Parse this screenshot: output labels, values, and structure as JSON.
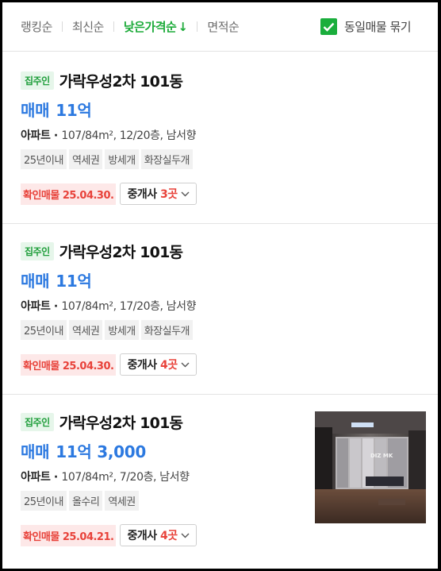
{
  "sortbar": {
    "items": [
      {
        "label": "랭킹순"
      },
      {
        "label": "최신순"
      },
      {
        "label": "낮은가격순"
      },
      {
        "label": "면적순"
      }
    ],
    "active_arrow": "↓",
    "group_toggle_label": "동일매물 묶기",
    "accent_color": "#1dab3a"
  },
  "listings": [
    {
      "badge": "집주인",
      "name": "가락우성2차 101동",
      "price_type": "매매",
      "price": "11억",
      "spec_type": "아파트",
      "spec_detail": "107/84m², 12/20층, 남서향",
      "tags": [
        "25년이내",
        "역세권",
        "방세개",
        "화장실두개"
      ],
      "confirm": "확인매물 25.04.30.",
      "agent_label": "중개사",
      "agent_count": "3곳"
    },
    {
      "badge": "집주인",
      "name": "가락우성2차 101동",
      "price_type": "매매",
      "price": "11억",
      "spec_type": "아파트",
      "spec_detail": "107/84m², 17/20층, 남서향",
      "tags": [
        "25년이내",
        "역세권",
        "방세개",
        "화장실두개"
      ],
      "confirm": "확인매물 25.04.30.",
      "agent_label": "중개사",
      "agent_count": "4곳"
    },
    {
      "badge": "집주인",
      "name": "가락우성2차 101동",
      "price_type": "매매",
      "price": "11억 3,000",
      "spec_type": "아파트",
      "spec_detail": "107/84m², 7/20층, 남서향",
      "tags": [
        "25년이내",
        "올수리",
        "역세권"
      ],
      "confirm": "확인매물 25.04.21.",
      "agent_label": "중개사",
      "agent_count": "4곳",
      "thumbnail_watermark": "DIZ MK"
    }
  ]
}
